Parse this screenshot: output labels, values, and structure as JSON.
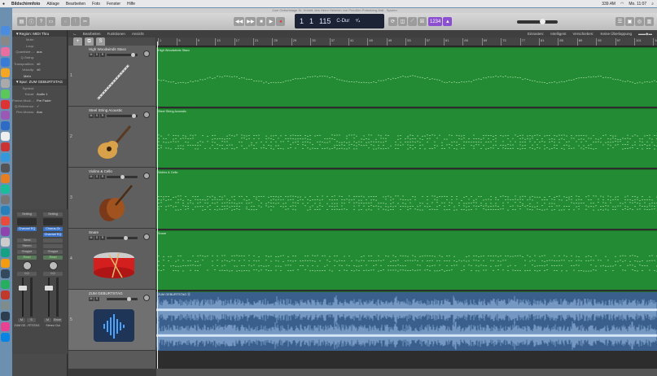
{
  "menubar": {
    "app": "Bildschirmfoto",
    "items": [
      "Ablage",
      "Bearbeiten",
      "Foto",
      "Fenster",
      "Hilfe"
    ],
    "status": [
      "339.4M",
      "Mo. 11:07"
    ]
  },
  "window": {
    "title": "Zum Geburtstage Sr. Hoheit, des Herrn Heinrich von Preußen Potenberg-Kali - Spuren"
  },
  "transport": {
    "bar": "1",
    "beat": "1",
    "tempo": "115",
    "key": "C-Dur",
    "signature": "⁴⁄₄",
    "count": "1234"
  },
  "inspector": {
    "region_header": "Region: MIDI Thru",
    "region_rows": [
      {
        "label": "Mute:",
        "value": ""
      },
      {
        "label": "Loop:",
        "value": ""
      },
      {
        "label": "Quantisier...:",
        "value": "aus"
      },
      {
        "label": "Q-Swing:",
        "value": ""
      },
      {
        "label": "Transposition:",
        "value": "±0"
      },
      {
        "label": "Velocity:",
        "value": "±0"
      }
    ],
    "more": "Mehr",
    "track_header": "Spur: ZUM GEBURTSTAG",
    "track_rows": [
      {
        "label": "Symbol:",
        "value": ""
      },
      {
        "label": "Kanal:",
        "value": "Audio 1"
      },
      {
        "label": "Freeze-Modi...:",
        "value": "Pre Fader"
      },
      {
        "label": "Q-Reference:",
        "value": "✓"
      },
      {
        "label": "Flex-Modus:",
        "value": "Aus"
      }
    ]
  },
  "strips": [
    {
      "setting": "Setting",
      "eq": "Channel EQ",
      "send": "Send",
      "output": "Stereo",
      "group": "Gruppe",
      "auto": "Read",
      "value": "0,0",
      "m": "M",
      "s": "S",
      "name": "ZUM GE...RTSTAG"
    },
    {
      "setting": "Setting",
      "eq": "Chorus-Gr",
      "eq2": "Channel EQ",
      "send": "",
      "output": "",
      "group": "Gruppe",
      "auto": "Read",
      "value": "0,0",
      "m": "M",
      "s": "Bnce",
      "name": "Stereo Out"
    }
  ],
  "editbar": {
    "menus": [
      "Bearbeiten",
      "Funktionen",
      "Ansicht"
    ],
    "snap_label": "Einrasten:",
    "snap": "Intelligent",
    "drag_label": "Verschieben:",
    "drag": "Keine Überlappung"
  },
  "ruler": [
    "1",
    "5",
    "9",
    "13",
    "17",
    "21",
    "25",
    "29",
    "33",
    "37",
    "41",
    "45",
    "49",
    "53",
    "57",
    "61",
    "65",
    "69",
    "73",
    "77",
    "81",
    "85",
    "89",
    "93",
    "97",
    "101",
    "105"
  ],
  "tracks": [
    {
      "num": "1",
      "name": "High Woodwinds Stacc",
      "type": "midi",
      "icon": "clarinet-icon",
      "vol": 0.9
    },
    {
      "num": "2",
      "name": "Steel String Acoustic",
      "type": "midi",
      "icon": "acoustic-guitar-icon",
      "vol": 0.95
    },
    {
      "num": "3",
      "name": "Violins & Cello",
      "type": "midi",
      "icon": "violin-icon",
      "vol": 0.5
    },
    {
      "num": "4",
      "name": "Snare",
      "type": "midi",
      "icon": "snare-drum-icon",
      "vol": 0.65
    },
    {
      "num": "5",
      "name": "ZUM GEBURTSTAG",
      "type": "audio",
      "icon": "waveform-icon",
      "vol": 0.75
    }
  ],
  "regions": [
    "High Woodwinds Stacc",
    "Steel String Acoustic",
    "Violins & Cello",
    "Snare",
    "ZUM GEBURTSTAG ⓪"
  ],
  "colors": {
    "midi_region": "#228b33",
    "audio_region": "#3a5f8c",
    "accent": "#8b4fd1"
  }
}
